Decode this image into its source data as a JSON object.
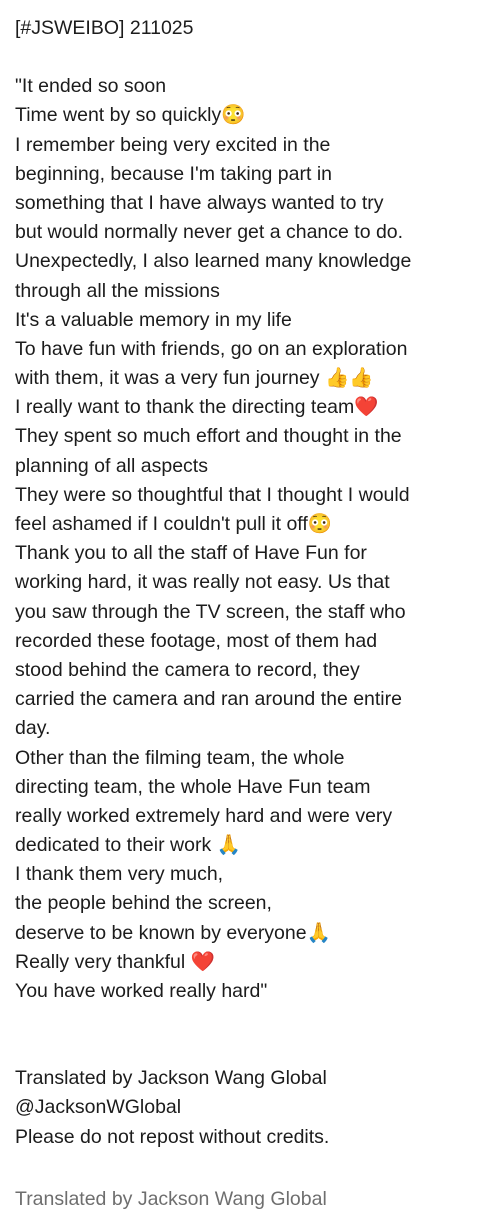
{
  "header": "[#JSWEIBO] 211025",
  "quote_lines": [
    "\"It ended so soon",
    "Time went by so quickly😳",
    "I remember being very excited in the",
    "beginning, because I'm taking part in",
    "something that I have always wanted to try",
    "but would normally never get a chance to do.",
    "Unexpectedly, I also learned many knowledge",
    "through all the missions",
    "It's a valuable memory in my life",
    "To have fun with friends, go on an exploration",
    "with them, it was a very fun journey 👍👍",
    "I really want to thank the directing team❤️",
    "They spent so much effort and thought in the",
    "planning of all aspects",
    "They were so thoughtful that I thought I would",
    "feel ashamed if I couldn't pull it off😳",
    "Thank you to all the staff of Have Fun for",
    "working hard, it was really not easy. Us that",
    "you saw through the TV screen, the staff who",
    "recorded these footage, most of them had",
    "stood behind the camera to record, they",
    "carried the camera and ran around the entire",
    "day.",
    "Other than the filming team, the whole",
    "directing team, the whole Have Fun team",
    "really worked extremely hard and were very",
    "dedicated to their work 🙏",
    "I thank them very much,",
    "the people behind the screen,",
    "deserve to be known by everyone🙏",
    "Really very thankful ❤️",
    "You have worked really hard\""
  ],
  "credits": {
    "line1": "Translated by Jackson Wang Global",
    "line2": "@JacksonWGlobal",
    "line3": "Please do not repost without credits."
  },
  "watermark": "Translated by Jackson Wang Global"
}
